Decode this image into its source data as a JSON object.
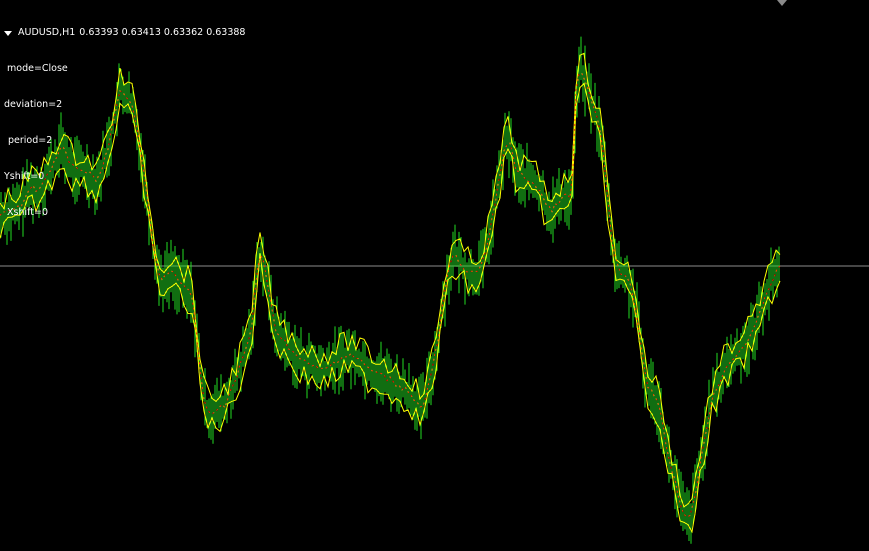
{
  "chart": {
    "symbol_timeframe": "AUDUSD,H1",
    "ohlc": "0.63393 0.63413 0.63362 0.63388",
    "params": [
      "mode=Close",
      "deviation=2",
      "period=2",
      "Yshift=0",
      "Xshift=0"
    ],
    "colors": {
      "background": "#000000",
      "bands": "#ffff00",
      "histogram": "#22dd22",
      "centerline": "#ff3300",
      "price_line": "#8c8c8c",
      "text": "#ffffff"
    },
    "icons": {
      "collapse": "triangle-down-icon",
      "shift_marker": "chart-shift-marker-icon"
    }
  },
  "chart_data": {
    "type": "line",
    "title": "AUDUSD,H1",
    "xlabel": "",
    "ylabel": "",
    "grid": false,
    "description_series": [
      {
        "name": "",
        "kind": "price-path"
      }
    ],
    "values": [
      0.634,
      0.634,
      0.6341,
      0.6341,
      0.6342,
      0.6341,
      0.6342,
      0.6343,
      0.6344,
      0.6345,
      0.6346,
      0.6345,
      0.6344,
      0.6343,
      0.6343,
      0.6344,
      0.6345,
      0.6344,
      0.6343,
      0.6342,
      0.6341,
      0.6342,
      0.6344,
      0.6346,
      0.6347,
      0.6347,
      0.6346,
      0.6345,
      0.6343,
      0.6342,
      0.6341,
      0.6339,
      0.6338,
      0.6337,
      0.6336,
      0.6336,
      0.6337,
      0.6336,
      0.6334,
      0.6331,
      0.633,
      0.633,
      0.6331,
      0.6332,
      0.6333,
      0.6334,
      0.6336,
      0.6338,
      0.6337,
      0.6336,
      0.6335,
      0.6334,
      0.6333,
      0.6334,
      0.6335,
      0.6334,
      0.6333,
      0.6334,
      0.6334,
      0.6333,
      0.6333,
      0.6334,
      0.6333,
      0.6332,
      0.6333,
      0.6334,
      0.6333,
      0.6333,
      0.6332,
      0.6332,
      0.6333,
      0.6332,
      0.6332,
      0.6332,
      0.6331,
      0.6331,
      0.6332,
      0.6333,
      0.6334,
      0.6335,
      0.6336,
      0.6337,
      0.6337,
      0.6339,
      0.6338,
      0.6338,
      0.6339,
      0.634,
      0.6342,
      0.6343,
      0.6344,
      0.6344,
      0.6343,
      0.6342,
      0.6343,
      0.6343,
      0.6342,
      0.6341,
      0.6341,
      0.6342,
      0.6343,
      0.6345,
      0.6347,
      0.6348,
      0.6347,
      0.6346,
      0.6344,
      0.6343,
      0.6339,
      0.6337,
      0.6336,
      0.6335,
      0.6333,
      0.6332,
      0.6331,
      0.633,
      0.633,
      0.6329,
      0.6328,
      0.6327,
      0.6328,
      0.6329,
      0.6331,
      0.6332,
      0.6333,
      0.6333,
      0.6334,
      0.6335,
      0.6336,
      0.6337,
      0.6338,
      0.6338,
      0.6339
    ]
  }
}
